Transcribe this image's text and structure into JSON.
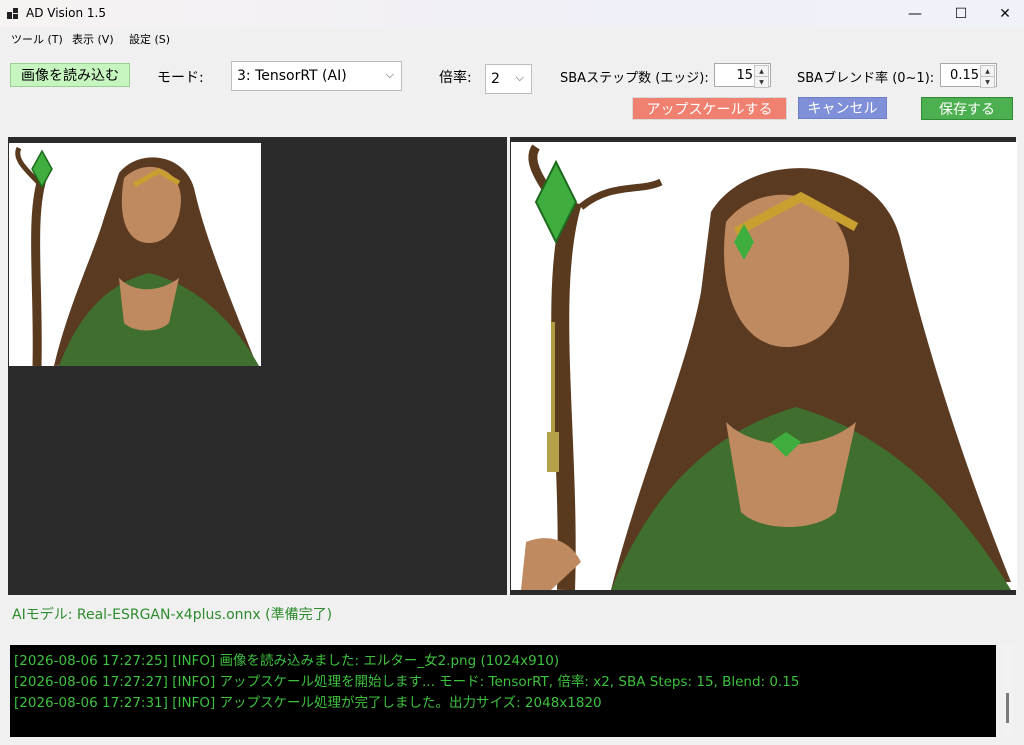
{
  "window": {
    "title": "AD Vision 1.5"
  },
  "window_controls": {
    "minimize": "—",
    "maximize": "☐",
    "close": "✕"
  },
  "menu": [
    "ツール (T)",
    "表示 (V)",
    "設定 (S)"
  ],
  "toolbar": {
    "load_button": "画像を読み込む",
    "mode_label": "モード:",
    "mode_value": "3: TensorRT (AI)",
    "scale_label": "倍率:",
    "scale_value": "2",
    "sba_steps_label": "SBAステップ数 (エッジ):",
    "sba_steps_value": "15",
    "sba_blend_label": "SBAブレンド率 (0~1):",
    "sba_blend_value": "0.15",
    "upscale_button": "アップスケールする",
    "cancel_button": "キャンセル",
    "save_button": "保存する"
  },
  "colors": {
    "load_button": "#c6f5c0",
    "upscale_button": "#f08070",
    "cancel_button": "#8090d8",
    "save_button": "#4caf50",
    "status_text": "#2e8b2e",
    "log_text": "#3ec13e"
  },
  "status": "AIモデル: Real-ESRGAN-x4plus.onnx (準備完了)",
  "log": [
    "[2026-08-06 17:27:25] [INFO] 画像を読み込みました: エルター_女2.png (1024x910)",
    "[2026-08-06 17:27:27] [INFO] アップスケール処理を開始します... モード: TensorRT, 倍率: x2, SBA Steps: 15, Blend: 0.15",
    "[2026-08-06 17:27:31] [INFO] アップスケール処理が完了しました。出力サイズ: 2048x1820"
  ]
}
